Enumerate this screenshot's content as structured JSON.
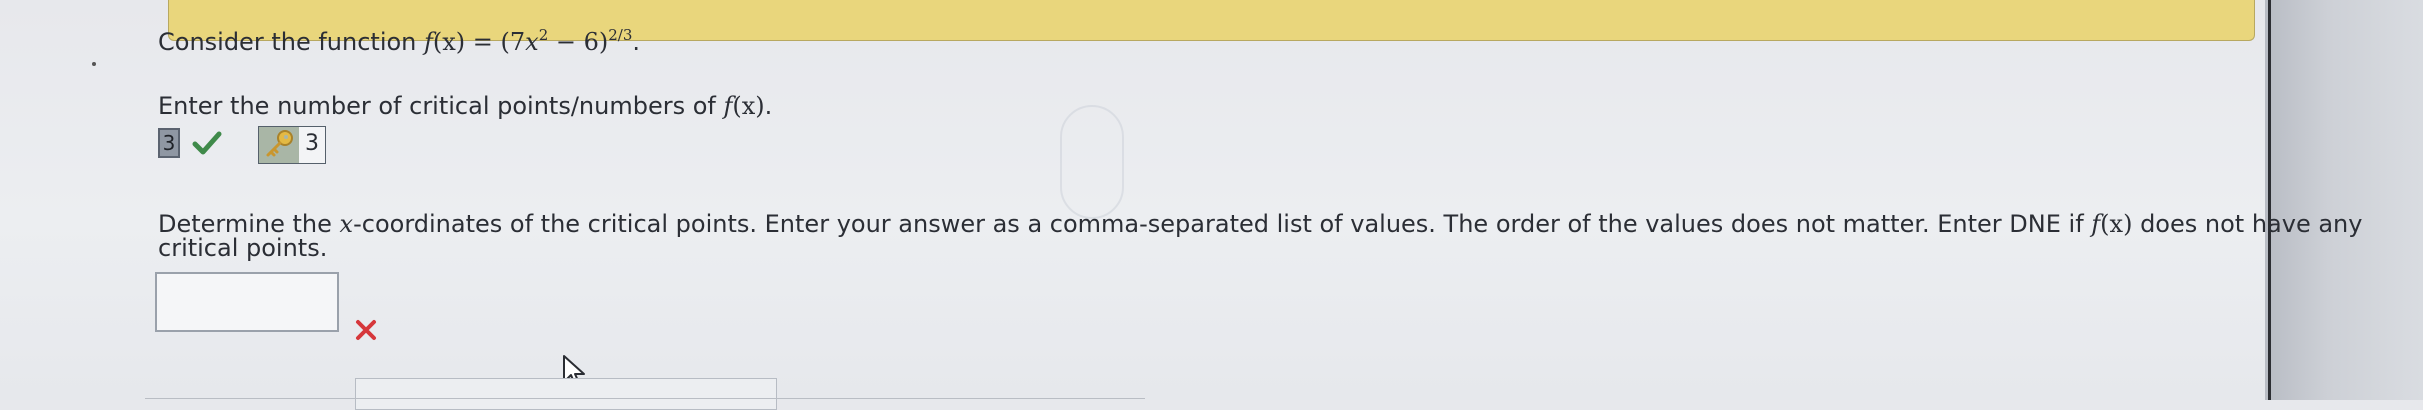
{
  "question": {
    "intro_prefix": "Consider the function ",
    "f_name": "f",
    "f_arg": "(x)",
    "eq": " = (7",
    "x_var": "x",
    "exp1": "2",
    "minus6": " − 6)",
    "exp2": "2/3",
    "period": ".",
    "part1_prefix": "Enter the number of critical points/numbers of ",
    "part1_f": "f",
    "part1_arg": "(x)",
    "part1_period": ".",
    "part2_line1_prefix": "Determine the ",
    "part2_x": "x",
    "part2_line1_mid": "-coordinates of the critical points. Enter your answer as a comma-separated list of values. The order of the values does not matter. Enter DNE if ",
    "part2_f": "f",
    "part2_arg": "(x)",
    "part2_line1_suffix": " does not have any",
    "part2_line2": "critical points."
  },
  "answer1": {
    "value": "3",
    "status_icon": "check-icon",
    "key_icon": "key-icon",
    "key_value": "3"
  },
  "answer2": {
    "value": "",
    "status_icon": "x-icon"
  },
  "colors": {
    "highlight_strip": "#e9d67c",
    "correct": "#3f8a4a",
    "incorrect": "#d6373b"
  }
}
